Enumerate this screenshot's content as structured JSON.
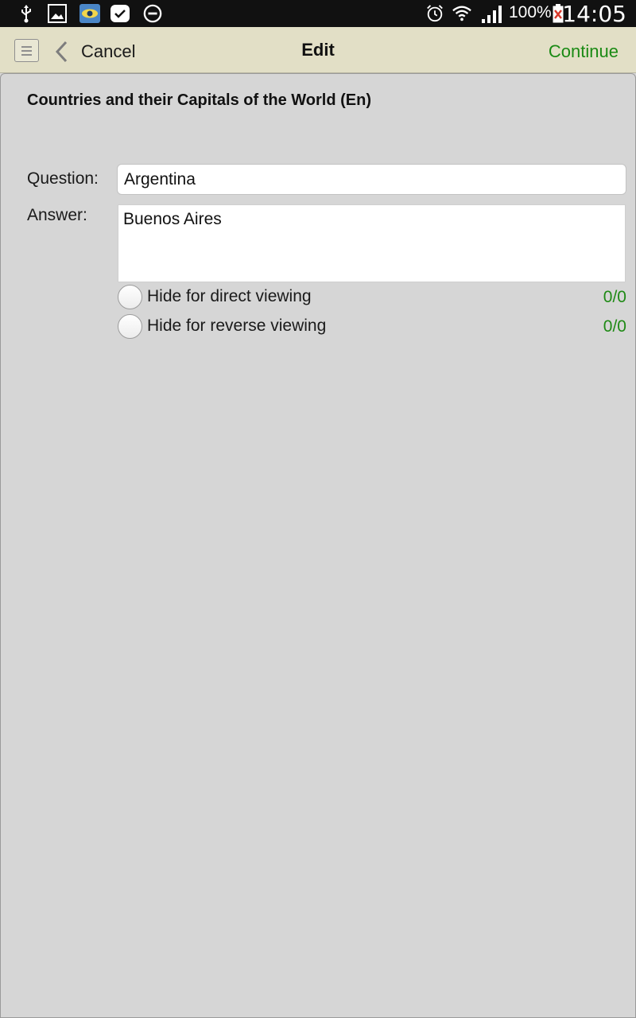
{
  "status_bar": {
    "left_icons": [
      "usb-icon",
      "image-icon",
      "app-eye-icon",
      "check-icon",
      "do-not-disturb-icon"
    ],
    "right_icons": [
      "alarm-icon",
      "wifi-icon",
      "signal-icon",
      "battery-icon"
    ],
    "battery_percent": "100%",
    "time": "14:05"
  },
  "action_bar": {
    "cancel_label": "Cancel",
    "title": "Edit",
    "continue_label": "Continue",
    "continue_color": "#1a8a14"
  },
  "content": {
    "deck_title": "Countries and their Capitals of the World (En)",
    "question_label": "Question:",
    "question_value": "Argentina",
    "answer_label": "Answer:",
    "answer_value": "Buenos Aires",
    "options": [
      {
        "label": "Hide for direct viewing",
        "count": "0/0",
        "selected": false
      },
      {
        "label": "Hide for reverse viewing",
        "count": "0/0",
        "selected": false
      }
    ],
    "count_color": "#1f8a15"
  }
}
